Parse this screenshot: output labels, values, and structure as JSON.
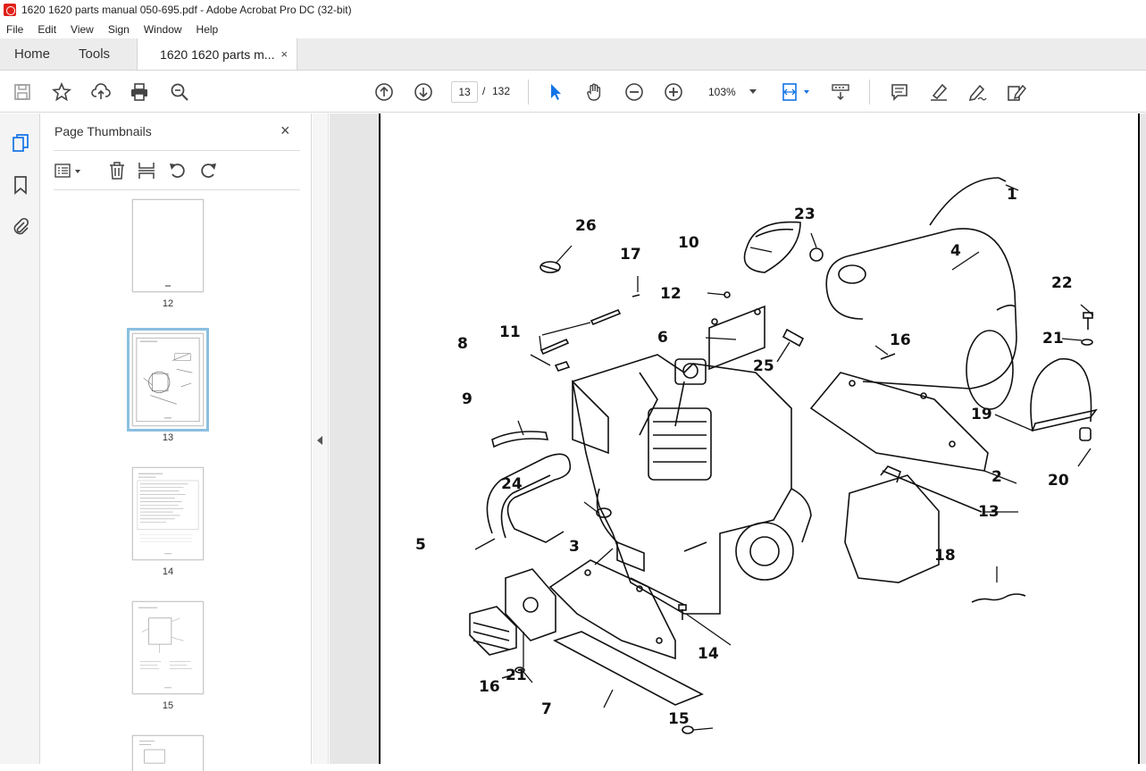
{
  "window": {
    "title": "1620 1620 parts manual 050-695.pdf - Adobe Acrobat Pro DC (32-bit)"
  },
  "menu": [
    "File",
    "Edit",
    "View",
    "Sign",
    "Window",
    "Help"
  ],
  "tabs": {
    "home": "Home",
    "tools": "Tools",
    "document": "1620 1620 parts m...",
    "close": "×"
  },
  "toolbar": {
    "current_page": "13",
    "separator": "/",
    "total_pages": "132",
    "zoom": "103%"
  },
  "thumbnails_panel": {
    "title": "Page Thumbnails",
    "close": "×",
    "pages": [
      {
        "label": "12"
      },
      {
        "label": "13",
        "selected": true
      },
      {
        "label": "14"
      },
      {
        "label": "15"
      }
    ]
  },
  "document": {
    "callouts": [
      "1",
      "4",
      "22",
      "21",
      "23",
      "10",
      "26",
      "17",
      "12",
      "6",
      "16",
      "25",
      "11",
      "8",
      "9",
      "19",
      "2",
      "20",
      "24",
      "13",
      "5",
      "3",
      "18",
      "14",
      "21",
      "16",
      "7",
      "15"
    ]
  },
  "colors": {
    "accent": "#1473e6",
    "selection": "#8bbfe0",
    "pdf_red": "#e0201a"
  }
}
